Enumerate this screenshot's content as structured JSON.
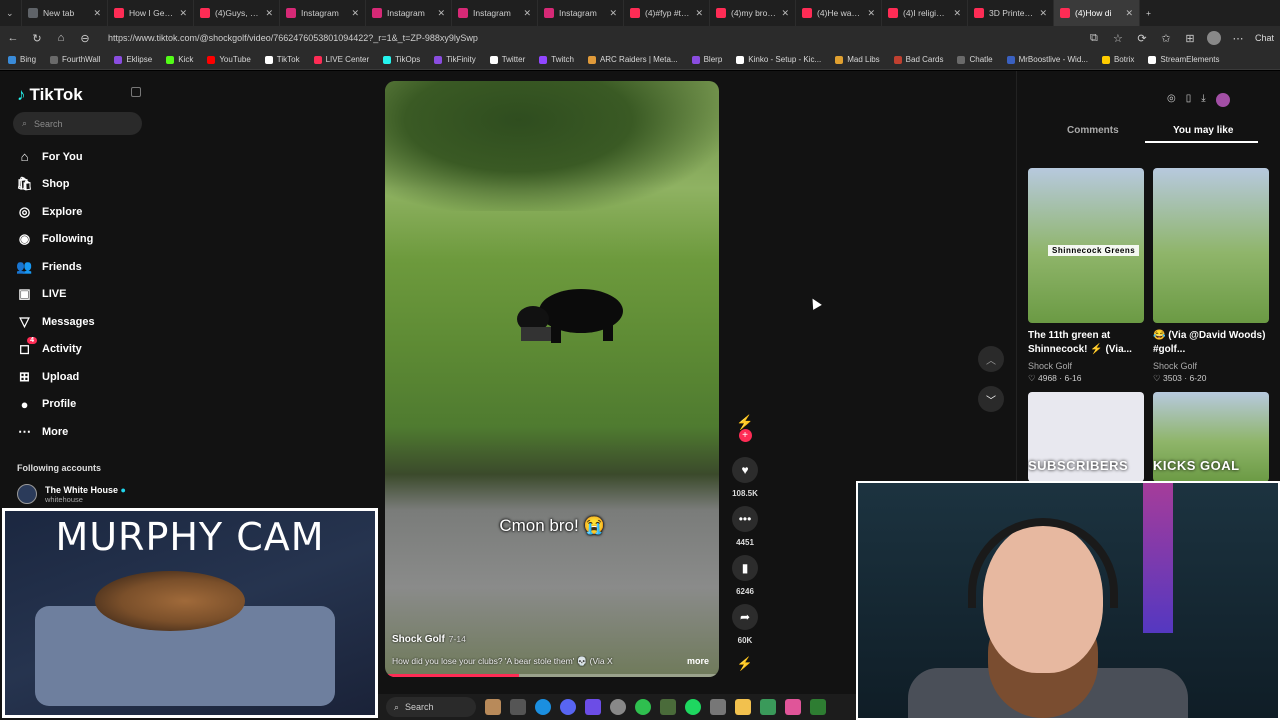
{
  "browser": {
    "tabs": [
      {
        "title": "New tab",
        "icon": "new-tab-icon",
        "color": "#5f6368"
      },
      {
        "title": "How I Get My /",
        "icon": "tiktok-icon",
        "color": "#fe2c55"
      },
      {
        "title": "(4)Guys, we ha",
        "icon": "tiktok-icon",
        "color": "#fe2c55"
      },
      {
        "title": "Instagram",
        "icon": "instagram-icon",
        "color": "#d62976"
      },
      {
        "title": "Instagram",
        "icon": "instagram-icon",
        "color": "#d62976"
      },
      {
        "title": "Instagram",
        "icon": "instagram-icon",
        "color": "#d62976"
      },
      {
        "title": "Instagram",
        "icon": "instagram-icon",
        "color": "#d62976"
      },
      {
        "title": "(4)#fyp #trend",
        "icon": "tiktok-icon",
        "color": "#fe2c55"
      },
      {
        "title": "(4)my brother",
        "icon": "tiktok-icon",
        "color": "#fe2c55"
      },
      {
        "title": "(4)He was okay",
        "icon": "tiktok-icon",
        "color": "#fe2c55"
      },
      {
        "title": "(4)I religiously",
        "icon": "tiktok-icon",
        "color": "#fe2c55"
      },
      {
        "title": "3D Printed Sw",
        "icon": "tiktok-icon",
        "color": "#fe2c55"
      },
      {
        "title": "(4)How di",
        "icon": "tiktok-icon",
        "color": "#fe2c55",
        "active": true
      }
    ],
    "url": "https://www.tiktok.com/@shockgolf/video/7662476053801094422?_r=1&_t=ZP-988xy9lySwp",
    "chat_label": "Chat",
    "bookmarks": [
      "Bing",
      "FourthWall",
      "Eklipse",
      "Kick",
      "YouTube",
      "TikTok",
      "LIVE Center",
      "TikOps",
      "TikFinity",
      "Twitter",
      "Twitch",
      "ARC Raiders | Meta...",
      "Blerp",
      "Kinko - Setup - Kic...",
      "Mad Libs",
      "Bad Cards",
      "Chatle",
      "MrBoostlive - Wid...",
      "Botrix",
      "StreamElements"
    ]
  },
  "tiktok": {
    "logo": "TikTok",
    "search_placeholder": "Search",
    "nav": [
      {
        "label": "For You",
        "icon": "home-icon"
      },
      {
        "label": "Shop",
        "icon": "shop-icon"
      },
      {
        "label": "Explore",
        "icon": "compass-icon"
      },
      {
        "label": "Following",
        "icon": "following-avatar-icon"
      },
      {
        "label": "Friends",
        "icon": "friends-icon"
      },
      {
        "label": "LIVE",
        "icon": "live-icon"
      },
      {
        "label": "Messages",
        "icon": "messages-icon"
      },
      {
        "label": "Activity",
        "icon": "activity-icon",
        "badge": "4"
      },
      {
        "label": "Upload",
        "icon": "upload-icon"
      },
      {
        "label": "Profile",
        "icon": "profile-icon"
      },
      {
        "label": "More",
        "icon": "more-icon"
      }
    ],
    "following_header": "Following accounts",
    "following_account": {
      "name": "The White House",
      "handle": "whitehouse"
    },
    "video": {
      "overlay_caption": "Cmon bro! 😭",
      "author": "Shock Golf",
      "date": "7-14",
      "description": "How did you lose your clubs? 'A bear stole them' 💀 (Via X",
      "more": "more",
      "progress": 0.4
    },
    "actions": {
      "likes": "108.5K",
      "comments": "4451",
      "saves": "6246",
      "shares": "60K"
    },
    "right_panel": {
      "tab_comments": "Comments",
      "tab_you_may_like": "You may like",
      "cards": [
        {
          "overlay": "Shinnecock Greens",
          "title": "The 11th green at Shinnecock! ⚡ (Via...",
          "author": "Shock Golf",
          "likes": "4968",
          "date": "6-16"
        },
        {
          "overlay": "",
          "title": "😂 (Via @David Woods) #golf...",
          "author": "Shock Golf",
          "likes": "3503",
          "date": "6-20"
        },
        {
          "overlay": "SUBSCRIBERS",
          "title": "",
          "author": "",
          "likes": "",
          "date": ""
        },
        {
          "overlay": "KICKS GOAL",
          "title": "",
          "author": "",
          "likes": "",
          "date": ""
        }
      ]
    }
  },
  "stream": {
    "murphy_cam_label": "MURPHY CAM"
  },
  "taskbar": {
    "search_label": "Search"
  }
}
